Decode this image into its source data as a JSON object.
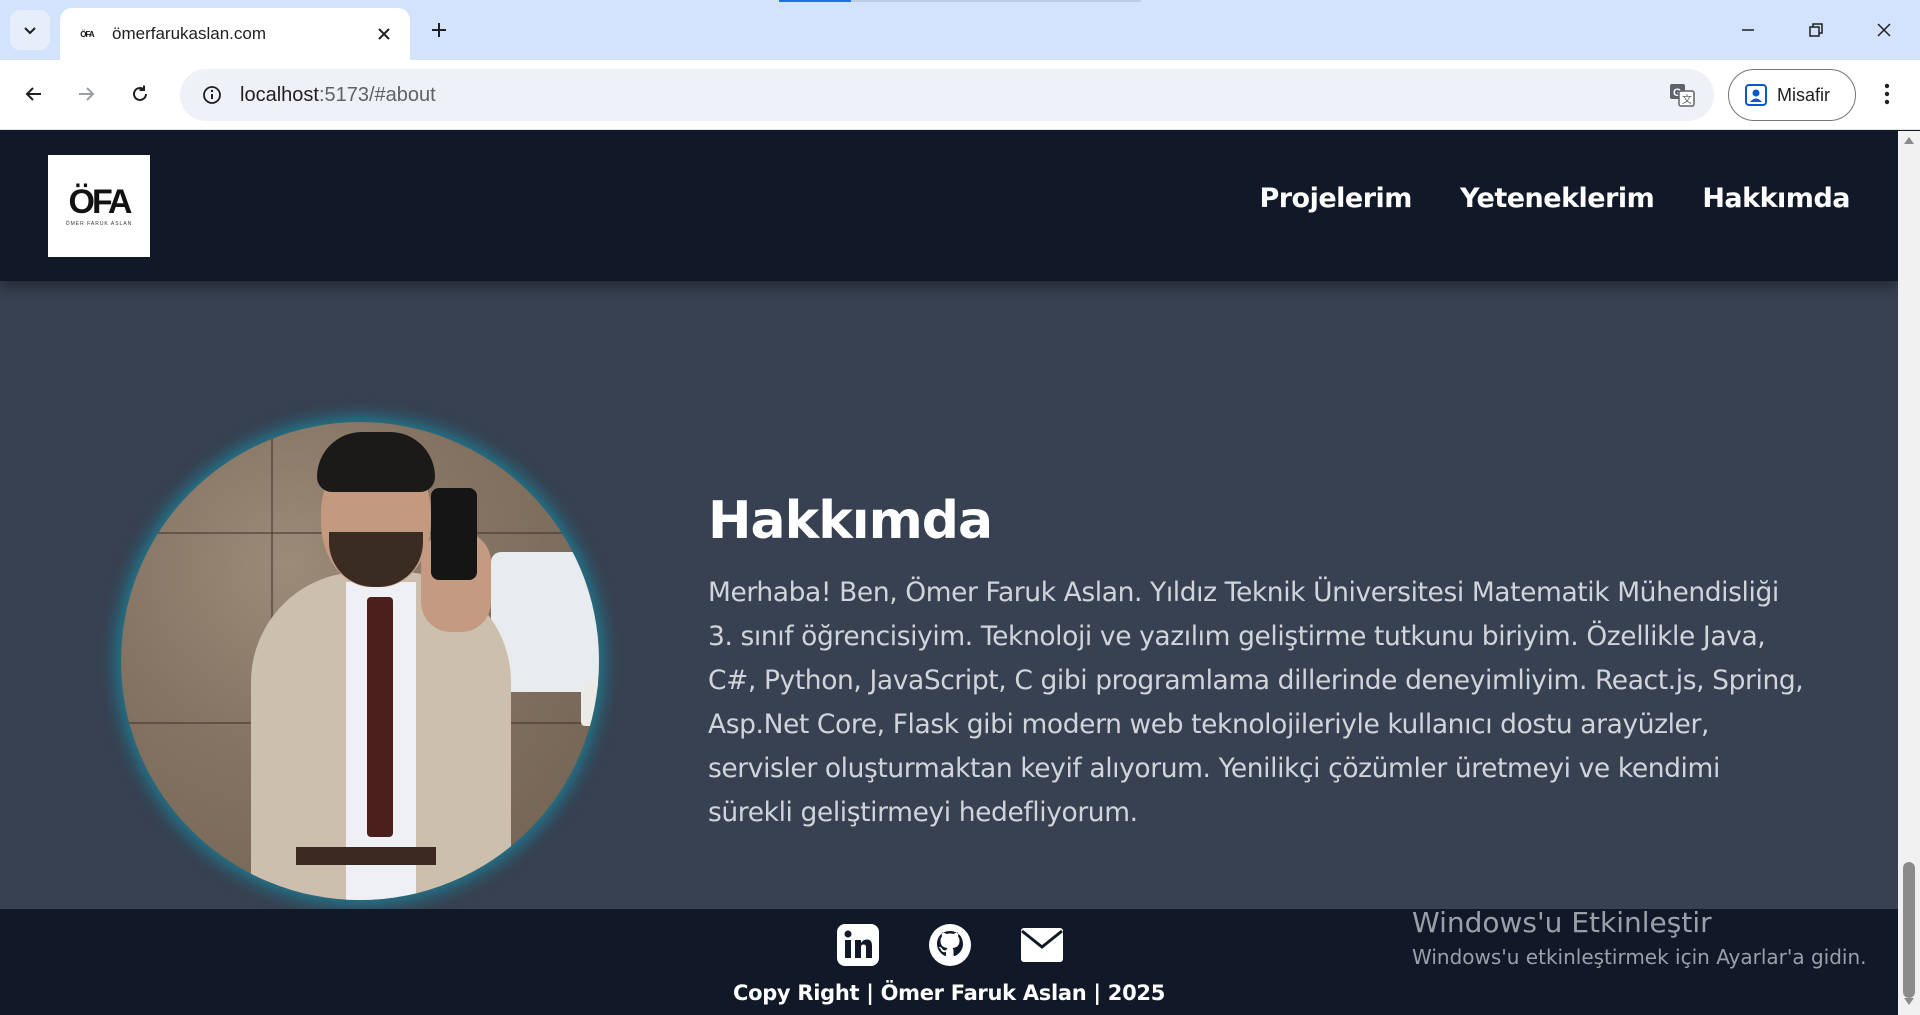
{
  "browser": {
    "tab_title": "ömerfarukaslan.com",
    "url_host": "localhost",
    "url_path": ":5173/#about",
    "profile_label": "Misafir"
  },
  "site": {
    "logo_text": "ÖFA",
    "logo_subtext": "ÖMER FARUK ASLAN",
    "nav": [
      {
        "label": "Projelerim"
      },
      {
        "label": "Yeteneklerim"
      },
      {
        "label": "Hakkımda"
      }
    ],
    "about": {
      "title": "Hakkımda",
      "body": "Merhaba! Ben, Ömer Faruk Aslan. Yıldız Teknik Üniversitesi Matematik Mühendisliği 3. sınıf öğrencisiyim. Teknoloji ve yazılım geliştirme tutkunu biriyim. Özellikle Java, C#, Python, JavaScript, C gibi programlama dillerinde deneyimliyim. React.js, Spring, Asp.Net Core, Flask gibi modern web teknolojileriyle kullanıcı dostu arayüzler, servisler oluşturmaktan keyif alıyorum. Yenilikçi çözümler üretmeyi ve kendimi sürekli geliştirmeyi hedefliyorum."
    },
    "footer": {
      "social": [
        {
          "icon": "linkedin-icon"
        },
        {
          "icon": "github-icon"
        },
        {
          "icon": "mail-icon"
        }
      ],
      "copyright": "Copy Right | Ömer Faruk Aslan | 2025"
    }
  },
  "watermark": {
    "title": "Windows'u Etkinleştir",
    "subtitle": "Windows'u etkinleştirmek için Ayarlar'a gidin."
  },
  "colors": {
    "header_bg": "#111827",
    "section_bg": "#374151",
    "accent_glow": "#06b6d4",
    "chrome_tabstrip": "#d3e3fd"
  }
}
